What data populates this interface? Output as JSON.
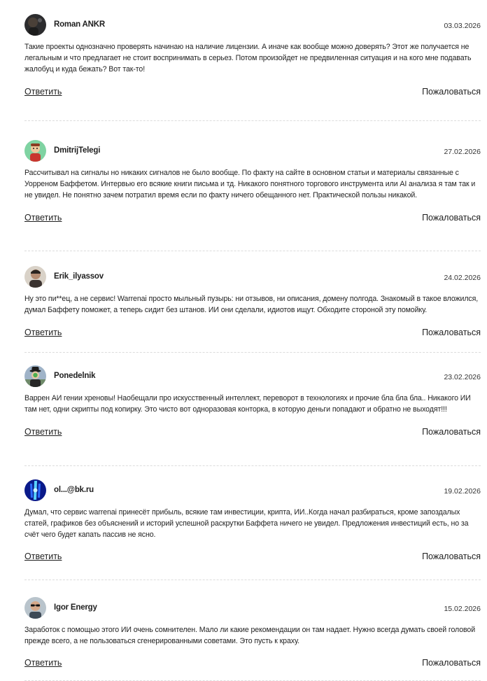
{
  "labels": {
    "reply": "Ответить",
    "report": "Пожаловаться"
  },
  "comments": [
    {
      "author": "Roman ANKR",
      "date": "03.03.2026",
      "avatar": "person-dark-photo",
      "text": "Такие проекты однозначно проверять начинаю на наличие лицензии. А иначе как вообще можно доверять? Этот же получается не легальным и что предлагает не стоит воспринимать в серьез. Потом произойдет не предвиленная ситуация и на кого мне подавать жалобуц и куда бежать? Вот так-то!"
    },
    {
      "author": "DmitrijTelegi",
      "date": "27.02.2026",
      "avatar": "cartoon-character-green",
      "text": "Рассчитывал на сигналы но никаких сигналов не было вообще. По факту на сайте в основном статьи и материалы связанные с Уорреном Баффетом. Интервью его всякие книги письма и тд. Никакого понятного торгового инструмента или AI анализа я там так и не увидел. Не понятно зачем потратил время если по факту ничего обещанного нет. Практической пользы никакой."
    },
    {
      "author": "Erik_ilyassov",
      "date": "24.02.2026",
      "avatar": "person-photo",
      "text": "Ну это пи**ец, а не сервис! Warrenai просто мыльный пузырь: ни отзывов, ни описания, домену полгода. Знакомый в такое вложился, думал Баффету поможет, а теперь сидит без штанов. ИИ они сделали, идиотов ищут. Обходите стороной эту помойку."
    },
    {
      "author": "Ponedelnik",
      "date": "23.02.2026",
      "avatar": "bowler-hat-painting",
      "text": "Варрен АИ гении хреновы! Наобещали про искусственный интеллект, переворот в технологиях и прочие бла бла бла.. Никакого ИИ там нет, одни скрипты под копирку. Это чисто вот одноразовая конторка, в которую деньги попадают и обратно не выходят!!!"
    },
    {
      "author": "ol...@bk.ru",
      "date": "19.02.2026",
      "avatar": "blue-abstract",
      "text": "Думал, что сервис warrenai принесёт прибыль, всякие там инвестиции, крипта, ИИ..Когда начал разбираться, кроме запоздалых статей, графиков без объяснений и историй успешной раскрутки Баффета ничего не увидел. Предложения инвестиций есть, но за счёт чего будет капать пассив не ясно."
    },
    {
      "author": "Igor Energy",
      "date": "15.02.2026",
      "avatar": "person-sunglasses-photo",
      "text": "Заработок с помощью этого ИИ очень сомнителен. Мало ли какие рекомендации он там надает. Нужно всегда думать своей головой прежде всего, а не пользоваться сгенерированными советами. Это пусть к краху."
    }
  ]
}
